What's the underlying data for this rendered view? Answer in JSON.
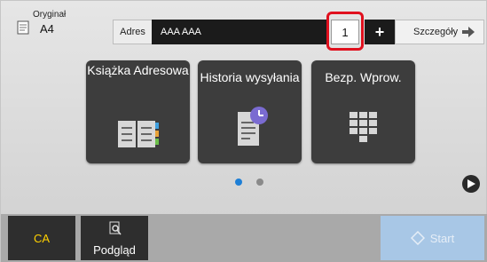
{
  "original": {
    "label": "Oryginał",
    "size": "A4",
    "icon": "document-icon"
  },
  "address": {
    "label": "Adres",
    "value": "AAA AAA",
    "count": "1",
    "add_icon": "plus-icon",
    "details_label": "Szczegóły",
    "details_icon": "arrow-right-icon"
  },
  "tiles": [
    {
      "label": "Książka Adresowa",
      "icon": "address-book-icon"
    },
    {
      "label": "Historia wysyłania",
      "icon": "send-history-icon"
    },
    {
      "label": "Bezp. Wprow.",
      "icon": "keypad-icon"
    }
  ],
  "pager": {
    "pages": 2,
    "active": 1,
    "next_icon": "play-right-icon"
  },
  "bottom": {
    "ca_label": "CA",
    "preview_label": "Podgląd",
    "preview_icon": "preview-magnifier-icon",
    "start_label": "Start",
    "start_icon": "diamond-start-icon"
  },
  "colors": {
    "accent_blue": "#1e7fd6",
    "highlight_red": "#e0101e",
    "ca_yellow": "#ffd100",
    "start_disabled": "#a8c7e6"
  }
}
